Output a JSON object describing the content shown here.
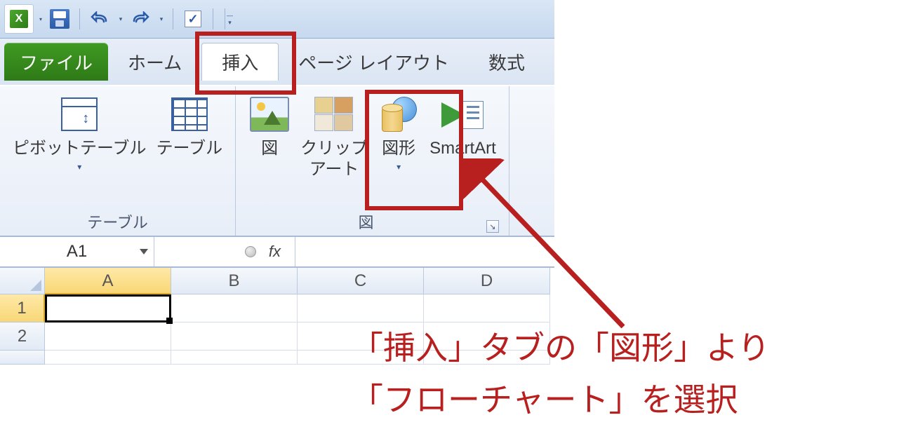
{
  "qat": {
    "save": "save",
    "undo": "undo",
    "redo": "redo",
    "check": "✓"
  },
  "tabs": {
    "file": "ファイル",
    "home": "ホーム",
    "insert": "挿入",
    "pageLayout": "ページ レイアウト",
    "formulas": "数式"
  },
  "ribbon": {
    "groupTables": "テーブル",
    "groupIllust": "図",
    "pivot": "ピボットテーブル",
    "table": "テーブル",
    "picture": "図",
    "clipart": "クリップ\nアート",
    "shapes": "図形",
    "smartart": "SmartArt"
  },
  "formulaBar": {
    "nameBox": "A1",
    "fx": "fx"
  },
  "columns": [
    "A",
    "B",
    "C",
    "D"
  ],
  "rows": [
    "1",
    "2"
  ],
  "annotation": {
    "line1": "「挿入」タブの「図形」より",
    "line2": "「フローチャート」を選択"
  }
}
